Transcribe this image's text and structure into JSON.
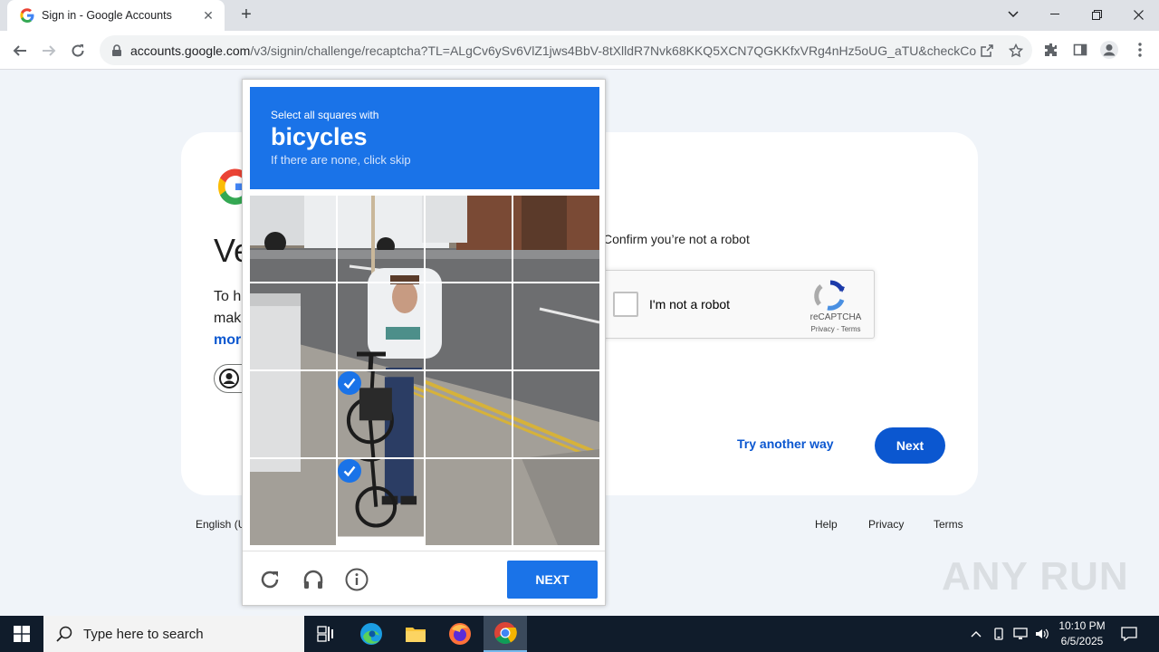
{
  "browser": {
    "tab_title": "Sign in - Google Accounts",
    "url_domain": "accounts.google.com",
    "url_path": "/v3/signin/challenge/recaptcha?TL=ALgCv6ySv6VlZ1jws4BbV-8tXlldR7Nvk68KKQ5XCN7QGKKfxVRg4nHz5oUG_aTU&checkConn..."
  },
  "signin": {
    "heading_partial": "Ve",
    "desc_line1": "To h",
    "desc_line2": "mak",
    "desc_more": "mor",
    "confirm_text": "Confirm you’re not a robot",
    "checkbox_label": "I'm not a robot",
    "recaptcha_brand": "reCAPTCHA",
    "recaptcha_links": "Privacy - Terms",
    "try_another": "Try another way",
    "next": "Next"
  },
  "footer": {
    "language": "English (U",
    "help": "Help",
    "privacy": "Privacy",
    "terms": "Terms"
  },
  "challenge": {
    "instruction": "Select all squares with",
    "object": "bicycles",
    "hint": "If there are none, click skip",
    "verify_button": "NEXT",
    "selected_tiles": [
      9,
      13
    ]
  },
  "watermark": "ANY RUN",
  "taskbar": {
    "search_placeholder": "Type here to search",
    "time": "10:10 PM",
    "date": "6/5/2025"
  },
  "colors": {
    "accent": "#1a73e8",
    "google_button": "#0b57d0",
    "taskbar": "#101c2b"
  }
}
